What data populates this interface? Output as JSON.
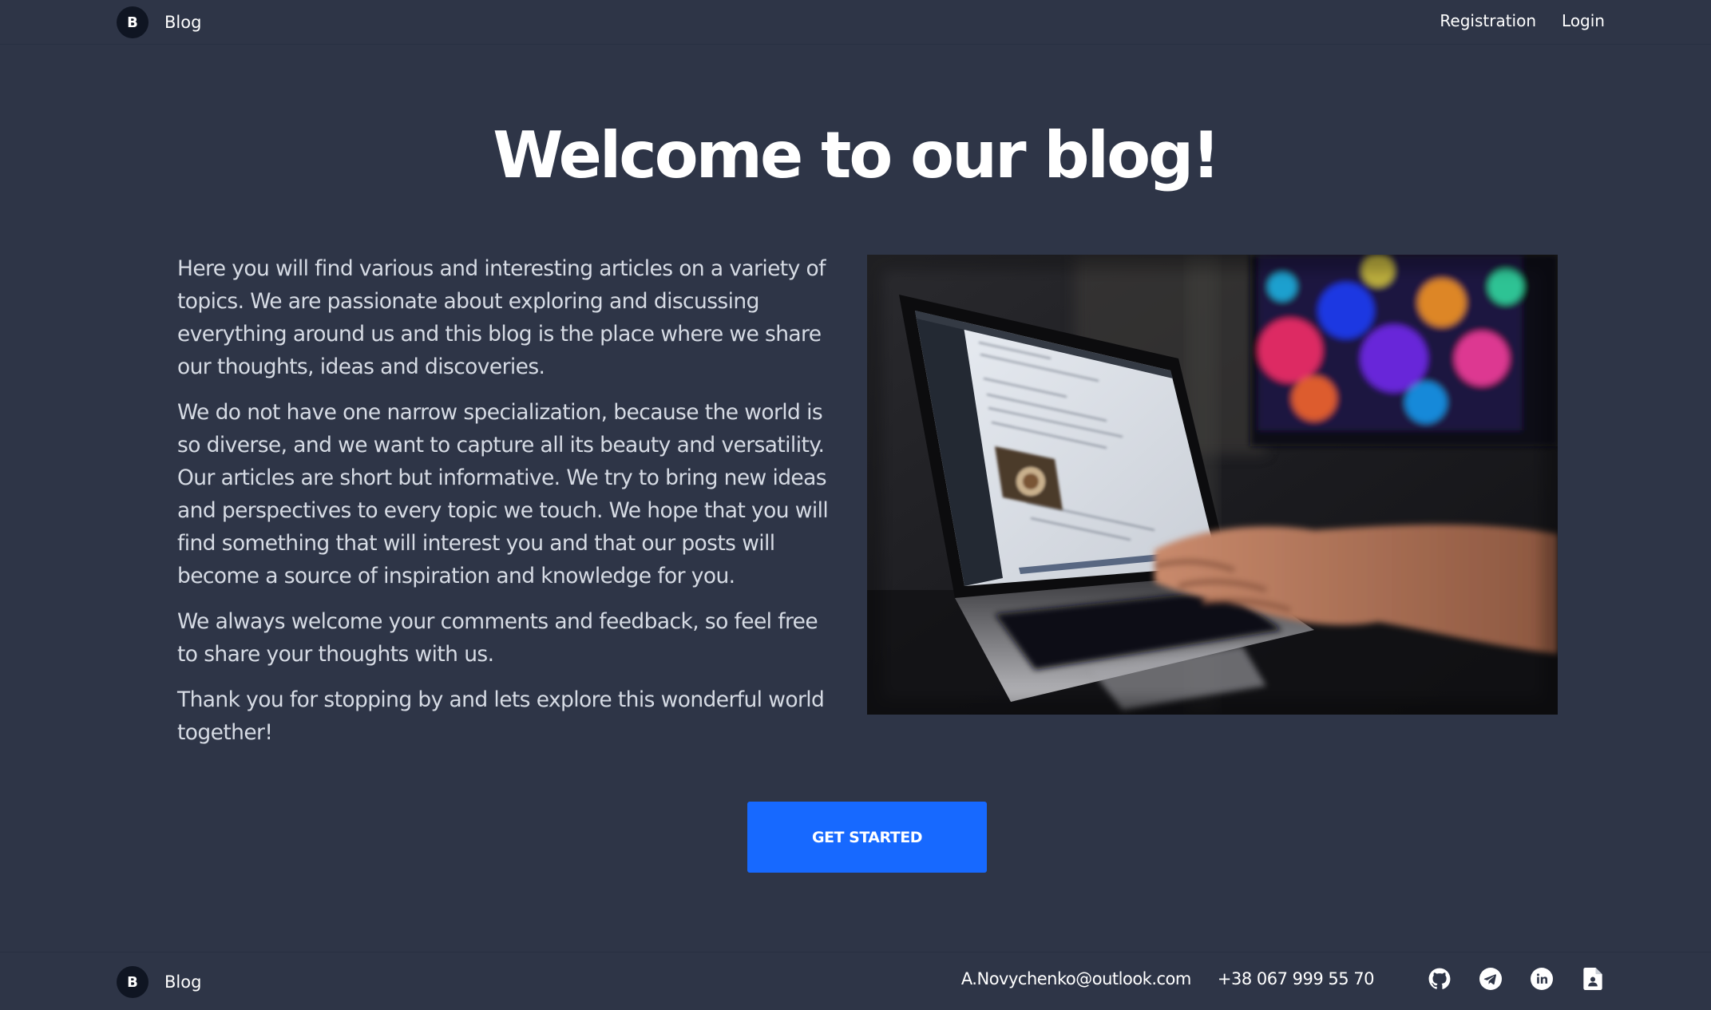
{
  "header": {
    "logo_letter": "B",
    "brand_name": "Blog",
    "nav": {
      "registration": "Registration",
      "login": "Login"
    }
  },
  "hero": {
    "title": "Welcome to our blog!",
    "paragraphs": [
      "Here you will find various and interesting articles on a variety of topics. We are passionate about exploring and discussing everything around us and this blog is the place where we share our thoughts, ideas and discoveries.",
      "We do not have one narrow specialization, because the world is so diverse, and we want to capture all its beauty and versatility. Our articles are short but informative. We try to bring new ideas and perspectives to every topic we touch. We hope that you will find something that will interest you and that our posts will become a source of inspiration and knowledge for you.",
      "We always welcome your comments and feedback, so feel free to share your thoughts with us.",
      "Thank you for stopping by and lets explore this wonderful world together!"
    ],
    "cta_label": "GET STARTED"
  },
  "footer": {
    "logo_letter": "B",
    "brand_name": "Blog",
    "email": "A.Novychenko@outlook.com",
    "phone": "+38 067 999 55 70",
    "icons": [
      "github-icon",
      "telegram-icon",
      "linkedin-icon",
      "resume-file-icon"
    ]
  },
  "colors": {
    "background": "#2e3547",
    "cta": "#1769ff",
    "logo_circle": "#0f1522",
    "body_text": "#d6dbe4"
  }
}
